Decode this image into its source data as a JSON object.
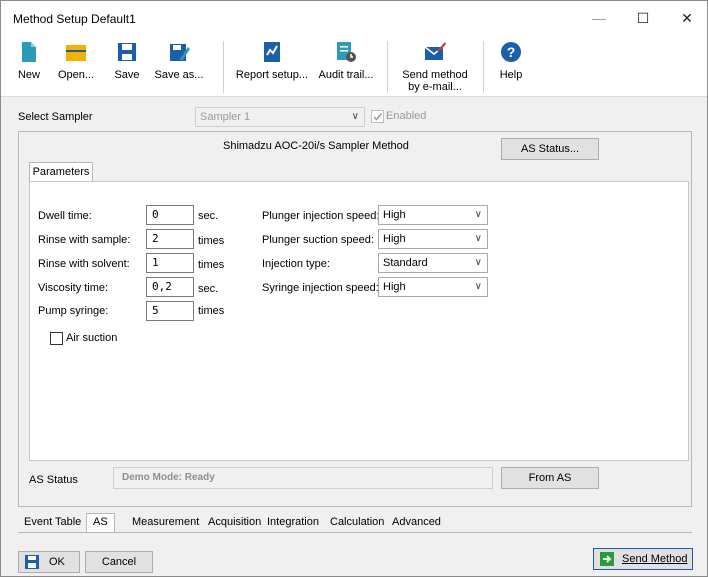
{
  "window": {
    "title": "Method Setup Default1",
    "minimize_glyph": "—",
    "maximize_glyph": "☐",
    "close_glyph": "✕"
  },
  "toolbar": {
    "items": [
      {
        "label": "New",
        "icon": "new-document-icon"
      },
      {
        "label": "Open...",
        "icon": "open-folder-icon"
      },
      {
        "label": "Save",
        "icon": "save-icon"
      },
      {
        "label": "Save as...",
        "icon": "save-as-icon"
      },
      {
        "label": "Report setup...",
        "icon": "report-setup-icon"
      },
      {
        "label": "Audit trail...",
        "icon": "audit-trail-icon"
      },
      {
        "label": "Send method by e-mail...",
        "icon": "email-method-icon"
      },
      {
        "label": "Help",
        "icon": "help-icon"
      }
    ]
  },
  "sampler": {
    "label": "Select Sampler",
    "value": "Sampler 1",
    "enabled_label": "Enabled"
  },
  "panel": {
    "title": "Shimadzu AOC-20i/s Sampler Method",
    "as_status_button": "AS Status...",
    "tab": "Parameters",
    "left_fields": [
      {
        "label": "Dwell time:",
        "value": "0",
        "unit": "sec."
      },
      {
        "label": "Rinse with sample:",
        "value": "2",
        "unit": "times"
      },
      {
        "label": "Rinse with solvent:",
        "value": "1",
        "unit": "times"
      },
      {
        "label": "Viscosity time:",
        "value": "0,2",
        "unit": "sec."
      },
      {
        "label": "Pump syringe:",
        "value": "5",
        "unit": "times"
      }
    ],
    "air_suction_label": "Air suction",
    "right_fields": [
      {
        "label": "Plunger injection speed:",
        "value": "High"
      },
      {
        "label": "Plunger suction speed:",
        "value": "High"
      },
      {
        "label": "Injection type:",
        "value": "Standard"
      },
      {
        "label": "Syringe injection speed:",
        "value": "High"
      }
    ],
    "status_label": "AS Status",
    "status_value": "Demo Mode: Ready",
    "from_as_button": "From AS"
  },
  "bottom_tabs": [
    "Event Table",
    "AS",
    "Measurement",
    "Acquisition",
    "Integration",
    "Calculation",
    "Advanced"
  ],
  "active_tab": "AS",
  "footer": {
    "ok": "OK",
    "cancel": "Cancel",
    "send_method": "Send Method"
  },
  "colors": {
    "accent_blue": "#1a5fa8",
    "icon_teal": "#2a9bb8",
    "icon_yellow": "#f2b400",
    "send_green": "#2e9a3a"
  }
}
